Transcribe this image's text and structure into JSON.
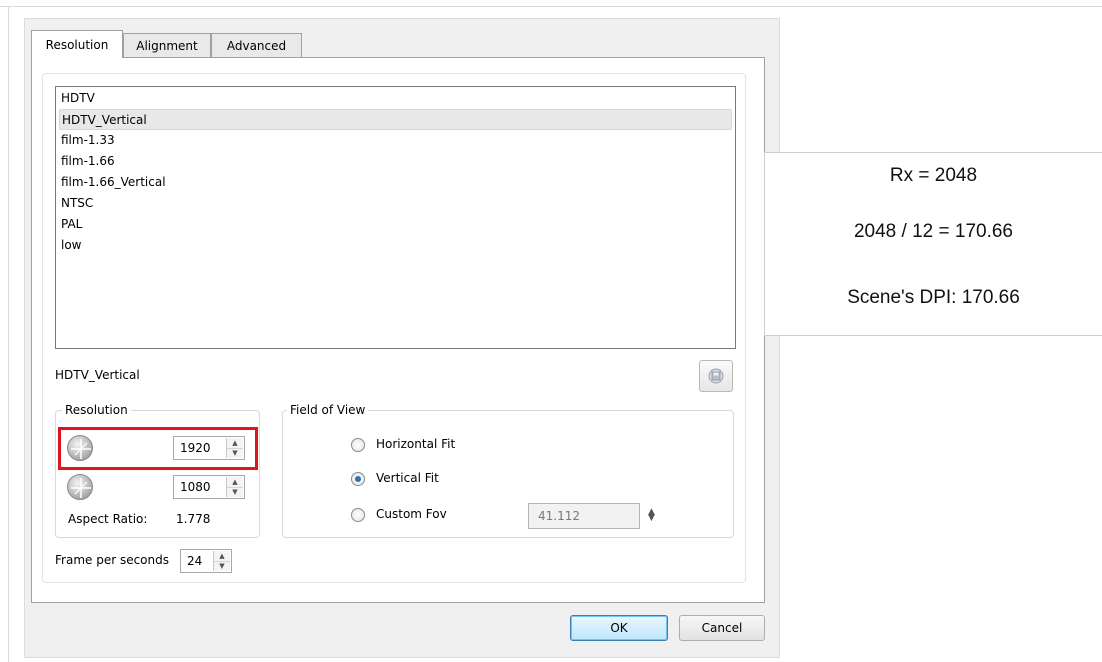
{
  "tabs": [
    {
      "label": "Resolution",
      "active": true
    },
    {
      "label": "Alignment",
      "active": false
    },
    {
      "label": "Advanced",
      "active": false
    }
  ],
  "presets": {
    "items": [
      "HDTV",
      "HDTV_Vertical",
      "film-1.33",
      "film-1.66",
      "film-1.66_Vertical",
      "NTSC",
      "PAL",
      "low"
    ],
    "selected": "HDTV_Vertical"
  },
  "preset_name": "HDTV_Vertical",
  "resolution": {
    "legend": "Resolution",
    "width": "1920",
    "height": "1080",
    "aspect_label": "Aspect Ratio:",
    "aspect_value": "1.778"
  },
  "fov": {
    "legend": "Field of View",
    "options": [
      {
        "label": "Horizontal Fit",
        "checked": false
      },
      {
        "label": "Vertical Fit",
        "checked": true
      },
      {
        "label": "Custom Fov",
        "checked": false
      }
    ],
    "custom_value": "41.112"
  },
  "fps": {
    "label": "Frame per seconds",
    "value": "24"
  },
  "buttons": {
    "ok": "OK",
    "cancel": "Cancel"
  },
  "annotation": {
    "line1": "Rx = 2048",
    "line2": "2048 / 12 = 170.66",
    "line3": "Scene's DPI: 170.66"
  },
  "colors": {
    "highlight": "#e0151f",
    "accent": "#2a6fb8"
  },
  "icons": [
    "save-preset-icon",
    "width-icon",
    "height-icon"
  ]
}
